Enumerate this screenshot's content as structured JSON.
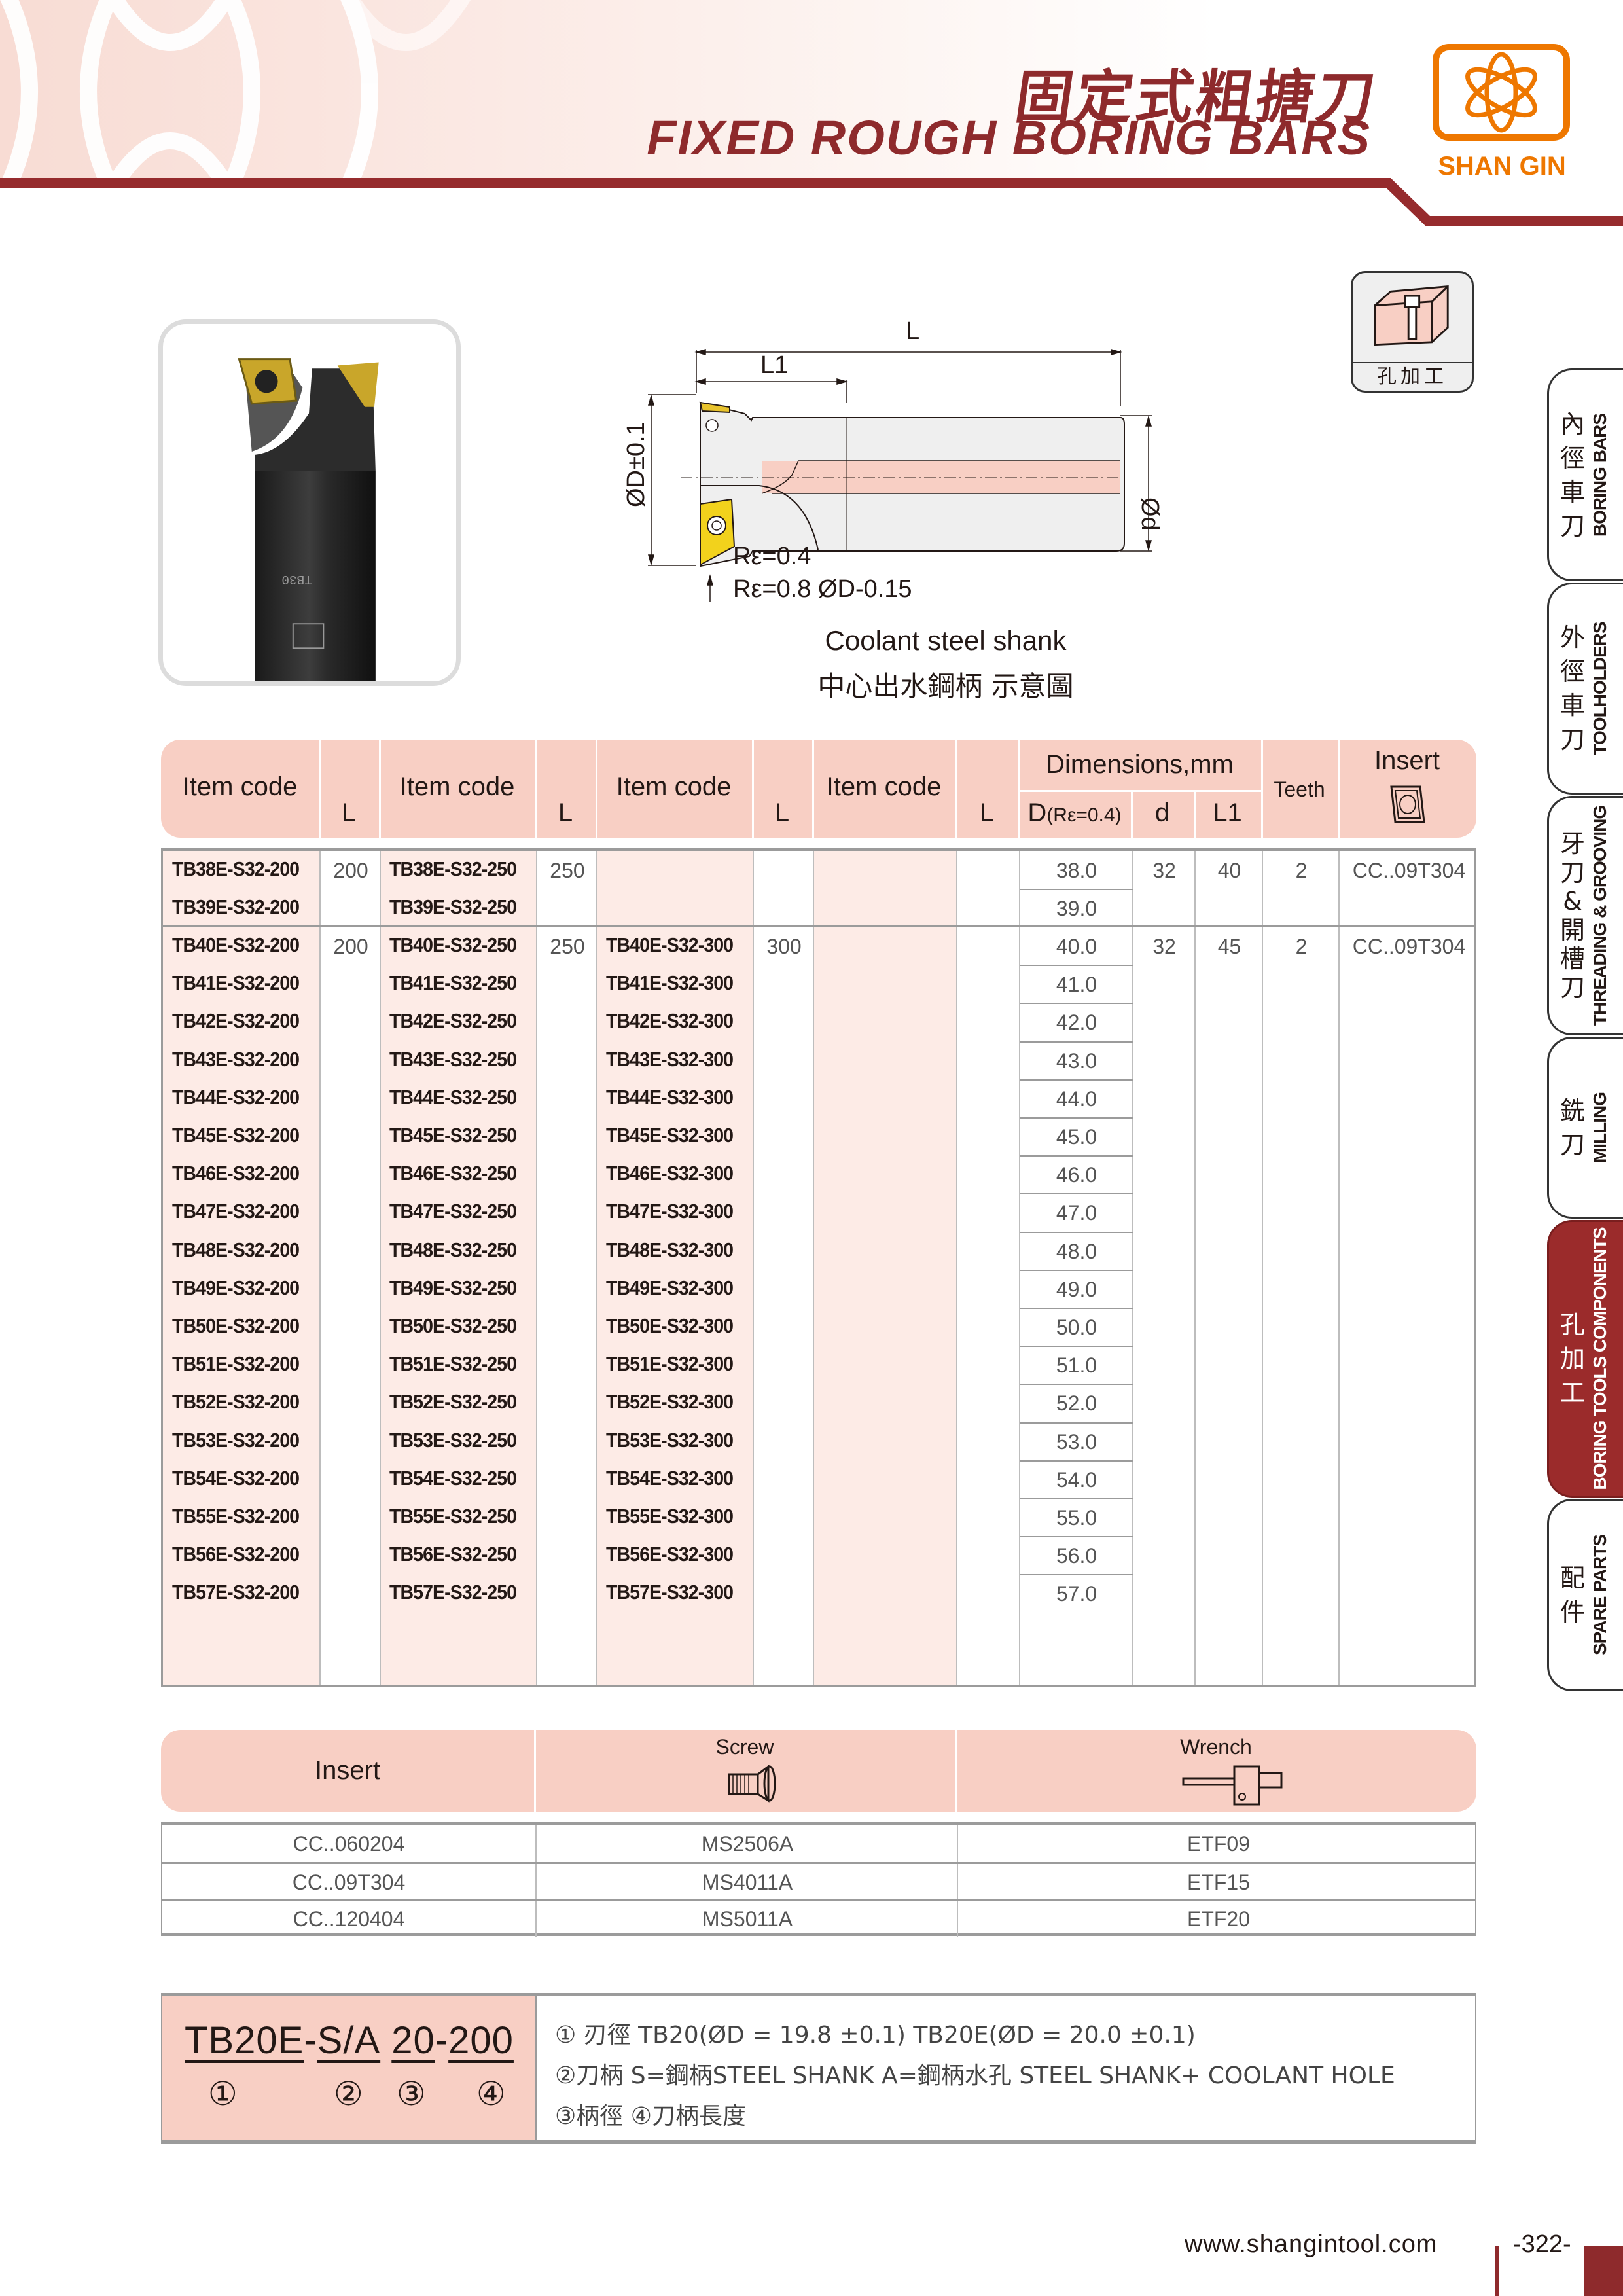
{
  "header": {
    "title_cn": "固定式粗搪刀",
    "title_en": "FIXED ROUGH BORING BARS",
    "brand": "SHAN GIN",
    "brand_color": "#ee7700",
    "accent_color": "#8e2a2c"
  },
  "category_icon": {
    "icon": "hole-machining-icon",
    "label": "孔加工"
  },
  "diagram": {
    "dim_L": "L",
    "dim_L1": "L1",
    "dim_D": "ØD±0.1",
    "dim_d": "Ød",
    "note_1": "Rε=0.4",
    "note_2": "Rε=0.8 ØD-0.15",
    "caption_en": "Coolant steel shank",
    "caption_cn": "中心出水鋼柄  示意圖"
  },
  "side_tabs": [
    {
      "cn": "內徑車刀",
      "en": "BORING BARS",
      "active": false
    },
    {
      "cn": "外徑車刀",
      "en": "TOOLHOLDERS",
      "active": false
    },
    {
      "cn": "牙刀&開槽刀",
      "en": "THREADING & GROOVING",
      "active": false
    },
    {
      "cn": "銑刀",
      "en": "MILLING",
      "active": false
    },
    {
      "cn": "孔加工",
      "en": "BORING TOOLS COMPONENTS",
      "active": true
    },
    {
      "cn": "配件",
      "en": "SPARE PARTS",
      "active": false
    }
  ],
  "main_table": {
    "headers": {
      "item_code": "Item code",
      "L": "L",
      "dimensions": "Dimensions,mm",
      "D": "D",
      "D_note": "(Rε=0.4)",
      "d": "d",
      "L1": "L1",
      "teeth": "Teeth",
      "insert": "Insert"
    },
    "group1": {
      "L_values": [
        "200",
        "250"
      ],
      "d": "32",
      "L1": "40",
      "teeth": "2",
      "insert": "CC..09T304",
      "rows": [
        {
          "code200": "TB38E-S32-200",
          "code250": "TB38E-S32-250",
          "D": "38.0"
        },
        {
          "code200": "TB39E-S32-200",
          "code250": "TB39E-S32-250",
          "D": "39.0"
        }
      ]
    },
    "group2": {
      "L_values": [
        "200",
        "250",
        "300"
      ],
      "d": "32",
      "L1": "45",
      "teeth": "2",
      "insert": "CC..09T304",
      "rows": [
        {
          "code200": "TB40E-S32-200",
          "code250": "TB40E-S32-250",
          "code300": "TB40E-S32-300",
          "D": "40.0"
        },
        {
          "code200": "TB41E-S32-200",
          "code250": "TB41E-S32-250",
          "code300": "TB41E-S32-300",
          "D": "41.0"
        },
        {
          "code200": "TB42E-S32-200",
          "code250": "TB42E-S32-250",
          "code300": "TB42E-S32-300",
          "D": "42.0"
        },
        {
          "code200": "TB43E-S32-200",
          "code250": "TB43E-S32-250",
          "code300": "TB43E-S32-300",
          "D": "43.0"
        },
        {
          "code200": "TB44E-S32-200",
          "code250": "TB44E-S32-250",
          "code300": "TB44E-S32-300",
          "D": "44.0"
        },
        {
          "code200": "TB45E-S32-200",
          "code250": "TB45E-S32-250",
          "code300": "TB45E-S32-300",
          "D": "45.0"
        },
        {
          "code200": "TB46E-S32-200",
          "code250": "TB46E-S32-250",
          "code300": "TB46E-S32-300",
          "D": "46.0"
        },
        {
          "code200": "TB47E-S32-200",
          "code250": "TB47E-S32-250",
          "code300": "TB47E-S32-300",
          "D": "47.0"
        },
        {
          "code200": "TB48E-S32-200",
          "code250": "TB48E-S32-250",
          "code300": "TB48E-S32-300",
          "D": "48.0"
        },
        {
          "code200": "TB49E-S32-200",
          "code250": "TB49E-S32-250",
          "code300": "TB49E-S32-300",
          "D": "49.0"
        },
        {
          "code200": "TB50E-S32-200",
          "code250": "TB50E-S32-250",
          "code300": "TB50E-S32-300",
          "D": "50.0"
        },
        {
          "code200": "TB51E-S32-200",
          "code250": "TB51E-S32-250",
          "code300": "TB51E-S32-300",
          "D": "51.0"
        },
        {
          "code200": "TB52E-S32-200",
          "code250": "TB52E-S32-250",
          "code300": "TB52E-S32-300",
          "D": "52.0"
        },
        {
          "code200": "TB53E-S32-200",
          "code250": "TB53E-S32-250",
          "code300": "TB53E-S32-300",
          "D": "53.0"
        },
        {
          "code200": "TB54E-S32-200",
          "code250": "TB54E-S32-250",
          "code300": "TB54E-S32-300",
          "D": "54.0"
        },
        {
          "code200": "TB55E-S32-200",
          "code250": "TB55E-S32-250",
          "code300": "TB55E-S32-300",
          "D": "55.0"
        },
        {
          "code200": "TB56E-S32-200",
          "code250": "TB56E-S32-250",
          "code300": "TB56E-S32-300",
          "D": "56.0"
        },
        {
          "code200": "TB57E-S32-200",
          "code250": "TB57E-S32-250",
          "code300": "TB57E-S32-300",
          "D": "57.0"
        }
      ]
    }
  },
  "accessory_table": {
    "headers": {
      "insert": "Insert",
      "screw": "Screw",
      "wrench": "Wrench"
    },
    "rows": [
      {
        "insert": "CC..060204",
        "screw": "MS2506A",
        "wrench": "ETF09"
      },
      {
        "insert": "CC..09T304",
        "screw": "MS4011A",
        "wrench": "ETF15"
      },
      {
        "insert": "CC..120404",
        "screw": "MS5011A",
        "wrench": "ETF20"
      }
    ]
  },
  "code_explanation": {
    "parts": [
      "TB20E",
      "-",
      "S/A",
      "20",
      "-",
      "200"
    ],
    "markers": [
      "①",
      "②",
      "③",
      "④"
    ],
    "lines": [
      "① 刃徑  TB20(ØD = 19.8 ±0.1)     TB20E(ØD = 20.0 ±0.1)",
      "②刀柄   S=鋼柄STEEL SHANK     A=鋼柄水孔 STEEL SHANK+ COOLANT HOLE",
      "③柄徑    ④刀柄長度"
    ]
  },
  "footer": {
    "url": "www.shangintool.com",
    "page": "-322-"
  }
}
